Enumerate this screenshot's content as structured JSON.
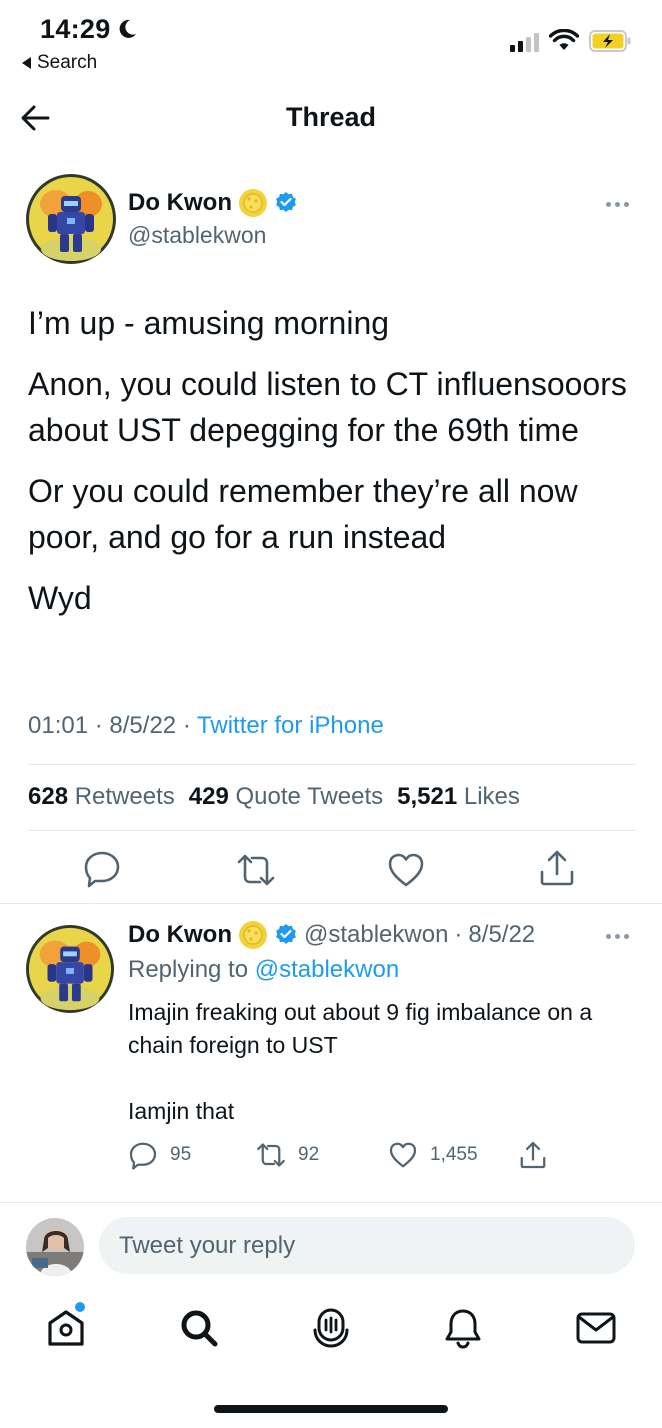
{
  "status_bar": {
    "time": "14:29",
    "back_app": "Search"
  },
  "header": {
    "title": "Thread"
  },
  "tweet": {
    "author_name": "Do Kwon",
    "handle": "@stablekwon",
    "paragraphs": [
      "I’m up - amusing morning",
      "Anon, you could listen to CT influensooors about UST depegging for the 69th time",
      "Or you could remember they’re all now poor, and go for a run instead",
      "Wyd"
    ],
    "time": "01:01",
    "date": "8/5/22",
    "source": "Twitter for iPhone",
    "retweets_count": "628",
    "retweets_label": "Retweets",
    "quotes_count": "429",
    "quotes_label": "Quote Tweets",
    "likes_count": "5,521",
    "likes_label": "Likes"
  },
  "reply": {
    "author_name": "Do Kwon",
    "handle": "@stablekwon",
    "date": "8/5/22",
    "replying_prefix": "Replying to",
    "replying_to": "@stablekwon",
    "paragraphs": [
      "Imajin freaking out about 9 fig imbalance on a chain foreign to UST",
      "Iamjin that"
    ],
    "replies": "95",
    "retweets": "92",
    "likes": "1,455"
  },
  "compose": {
    "placeholder": "Tweet your reply"
  },
  "colors": {
    "accent": "#1d9bf0",
    "text": "#0f1419",
    "secondary": "#536471"
  },
  "tab_bar": [
    "home-icon",
    "search-icon",
    "spaces-icon",
    "notifications-icon",
    "messages-icon"
  ]
}
